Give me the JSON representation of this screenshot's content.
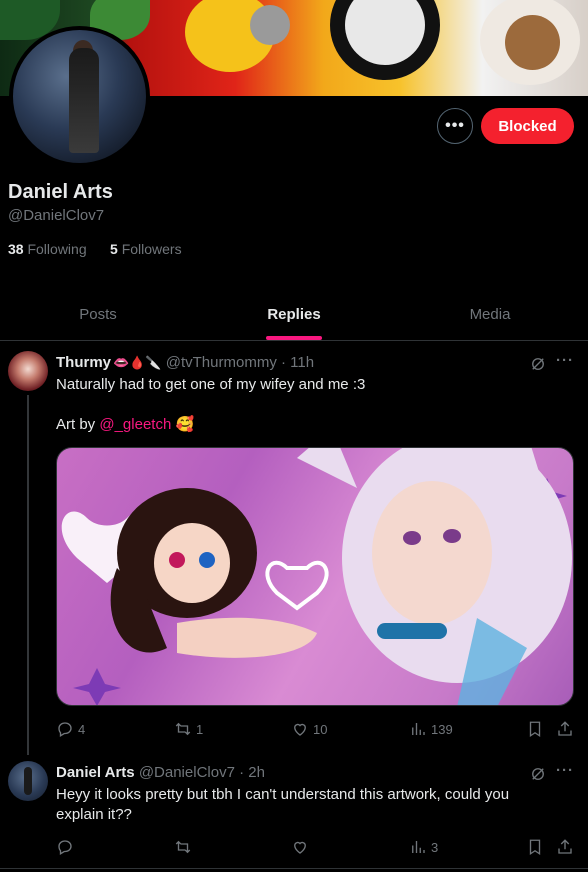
{
  "profile": {
    "name": "Daniel Arts",
    "handle": "@DanielClov7",
    "following_count": "38",
    "following_label": "Following",
    "followers_count": "5",
    "followers_label": "Followers",
    "more_label": "•••",
    "blocked_label": "Blocked"
  },
  "tabs": [
    {
      "label": "Posts",
      "active": false
    },
    {
      "label": "Replies",
      "active": true
    },
    {
      "label": "Media",
      "active": false
    }
  ],
  "posts": [
    {
      "name": "Thurmy",
      "emoji": "👄🩸🔪",
      "handle": "@tvThurmommy",
      "time": "· 11h",
      "line1": "Naturally had to get one of my wifey and me :3",
      "line2_prefix": "Art by ",
      "line2_link": "@_gleetch",
      "line2_emoji": "🥰",
      "replies": "4",
      "reposts": "1",
      "likes": "10",
      "views": "139"
    },
    {
      "name": "Daniel Arts",
      "handle": "@DanielClov7",
      "time": "· 2h",
      "line1": "Heyy it looks pretty but tbh I can't understand this artwork, could you",
      "line2": "explain it??",
      "views": "3"
    }
  ],
  "icons": [
    "more-icon",
    "grok-icon",
    "reply-icon",
    "repost-icon",
    "like-icon",
    "views-icon",
    "bookmark-icon",
    "share-icon"
  ],
  "colors": {
    "accent": "#f91880",
    "blocked": "#f4212e",
    "muted": "#71767b",
    "text": "#e7e9ea"
  }
}
